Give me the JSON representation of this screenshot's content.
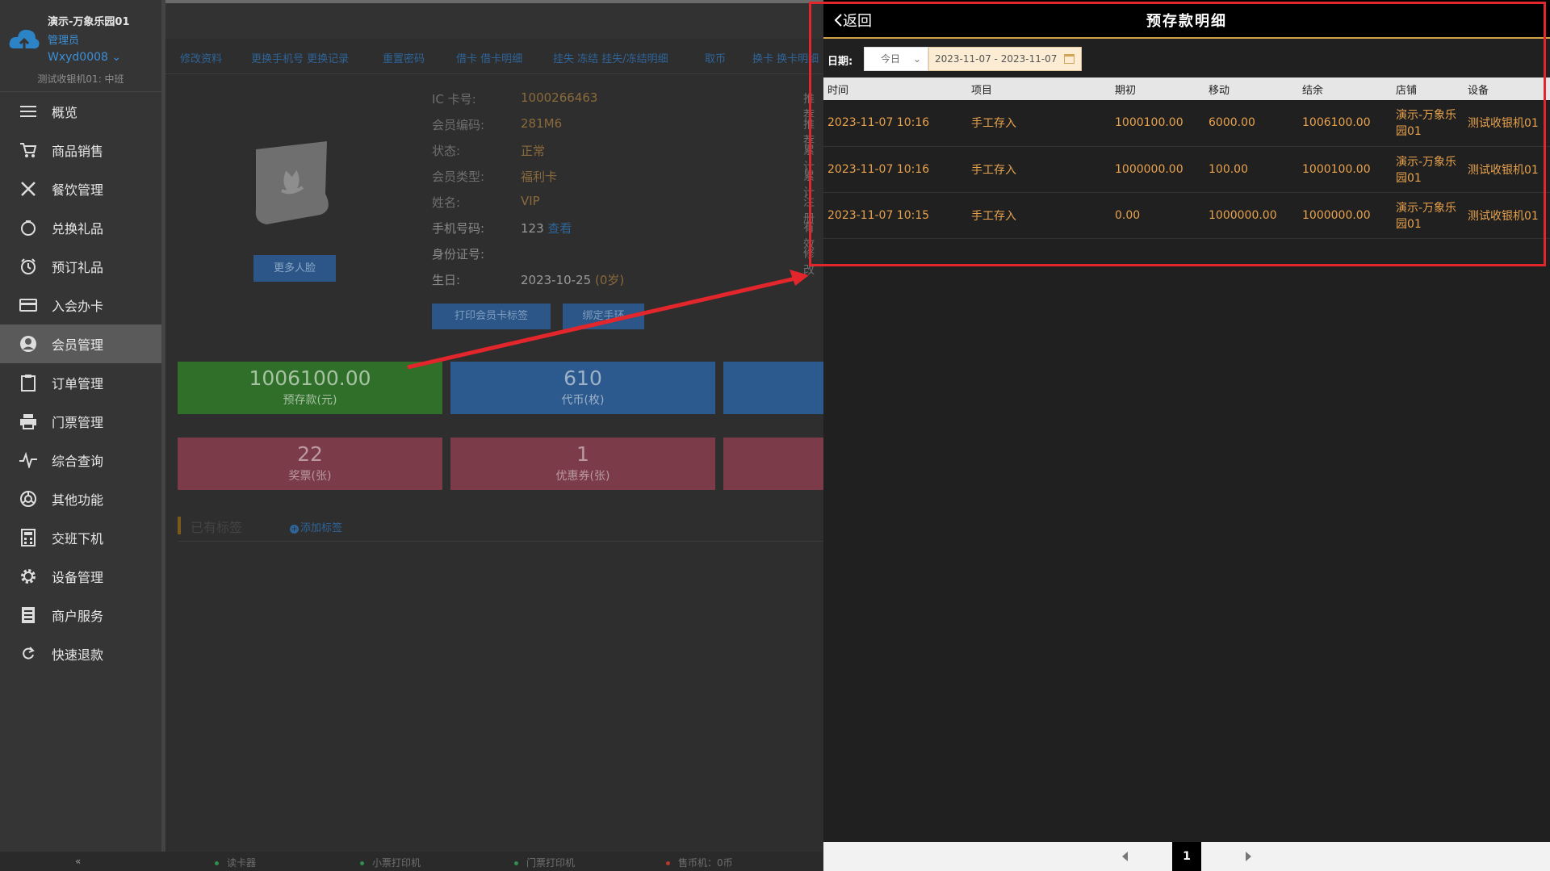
{
  "sidebar": {
    "store_name": "演示-万象乐园01",
    "role": "管理员",
    "user": "Wxyd0008 ⌄",
    "cashier": "测试收银机01: 中班",
    "items": [
      {
        "label": "概览",
        "icon": "menu-icon"
      },
      {
        "label": "商品销售",
        "icon": "cart-icon"
      },
      {
        "label": "餐饮管理",
        "icon": "utensils-icon"
      },
      {
        "label": "兑换礼品",
        "icon": "gift-icon"
      },
      {
        "label": "预订礼品",
        "icon": "alarm-clock-icon"
      },
      {
        "label": "入会办卡",
        "icon": "card-icon"
      },
      {
        "label": "会员管理",
        "icon": "user-icon"
      },
      {
        "label": "订单管理",
        "icon": "clipboard-icon"
      },
      {
        "label": "门票管理",
        "icon": "printer-icon"
      },
      {
        "label": "综合查询",
        "icon": "pulse-icon"
      },
      {
        "label": "其他功能",
        "icon": "aperture-icon"
      },
      {
        "label": "交班下机",
        "icon": "calculator-icon"
      },
      {
        "label": "设备管理",
        "icon": "gear-icon"
      },
      {
        "label": "商户服务",
        "icon": "list-icon"
      },
      {
        "label": "快速退款",
        "icon": "refresh-icon"
      }
    ],
    "collapse": "«"
  },
  "statusbar": {
    "card_reader": "读卡器",
    "receipt_printer": "小票打印机",
    "ticket_printer": "门票打印机",
    "coin_machine": "售币机：0币",
    "colors": {
      "ok": "#2f8f4e",
      "error": "#b8372f"
    }
  },
  "main": {
    "subtabs": [
      "修改资料",
      "更换手机号 更换记录",
      "重置密码",
      "借卡 借卡明细",
      "挂失 冻结 挂失/冻结明细",
      "取币",
      "换卡 换卡明细"
    ],
    "more_face": "更多人脸",
    "info": [
      {
        "label": "IC 卡号:",
        "value": "1000266463"
      },
      {
        "label": "会员编码:",
        "value": "281M6"
      },
      {
        "label": "状态:",
        "value": "正常"
      },
      {
        "label": "会员类型:",
        "value": "福利卡"
      },
      {
        "label": "姓名:",
        "value": "VIP"
      },
      {
        "label": "手机号码:",
        "value": "123",
        "link": "查看"
      },
      {
        "label": "身份证号:",
        "value": ""
      },
      {
        "label": "生日:",
        "value": "2023-10-25",
        "age": "(0岁)"
      }
    ],
    "right_cut": [
      "推荐",
      "推荐",
      "累计",
      "累计",
      "注册",
      "有效",
      "修改"
    ],
    "btn_print": "打印会员卡标签",
    "btn_bind": "绑定手环",
    "stats": [
      {
        "value": "1006100.00",
        "label": "预存款(元)"
      },
      {
        "value": "610",
        "label": "代币(枚)"
      },
      {
        "value": "22",
        "label": "奖票(张)"
      },
      {
        "value": "1",
        "label": "优惠券(张)"
      }
    ],
    "tags_title": "已有标签",
    "add_tag": "添加标签"
  },
  "panel": {
    "back": "返回",
    "title": "预存款明细",
    "filter": {
      "label": "日期:",
      "select": "今日",
      "range": "2023-11-07 - 2023-11-07"
    },
    "columns": [
      "时间",
      "项目",
      "期初",
      "移动",
      "结余",
      "店铺",
      "设备"
    ],
    "rows": [
      [
        "2023-11-07 10:16",
        "手工存入",
        "1000100.00",
        "6000.00",
        "1006100.00",
        "演示-万象乐园01",
        "测试收银机01"
      ],
      [
        "2023-11-07 10:16",
        "手工存入",
        "1000000.00",
        "100.00",
        "1000100.00",
        "演示-万象乐园01",
        "测试收银机01"
      ],
      [
        "2023-11-07 10:15",
        "手工存入",
        "0.00",
        "1000000.00",
        "1000000.00",
        "演示-万象乐园01",
        "测试收银机01"
      ]
    ],
    "page": "1"
  },
  "colors": {
    "accent": "#d4a14b",
    "value": "#e8a24d",
    "annotation": "#e3262b"
  }
}
